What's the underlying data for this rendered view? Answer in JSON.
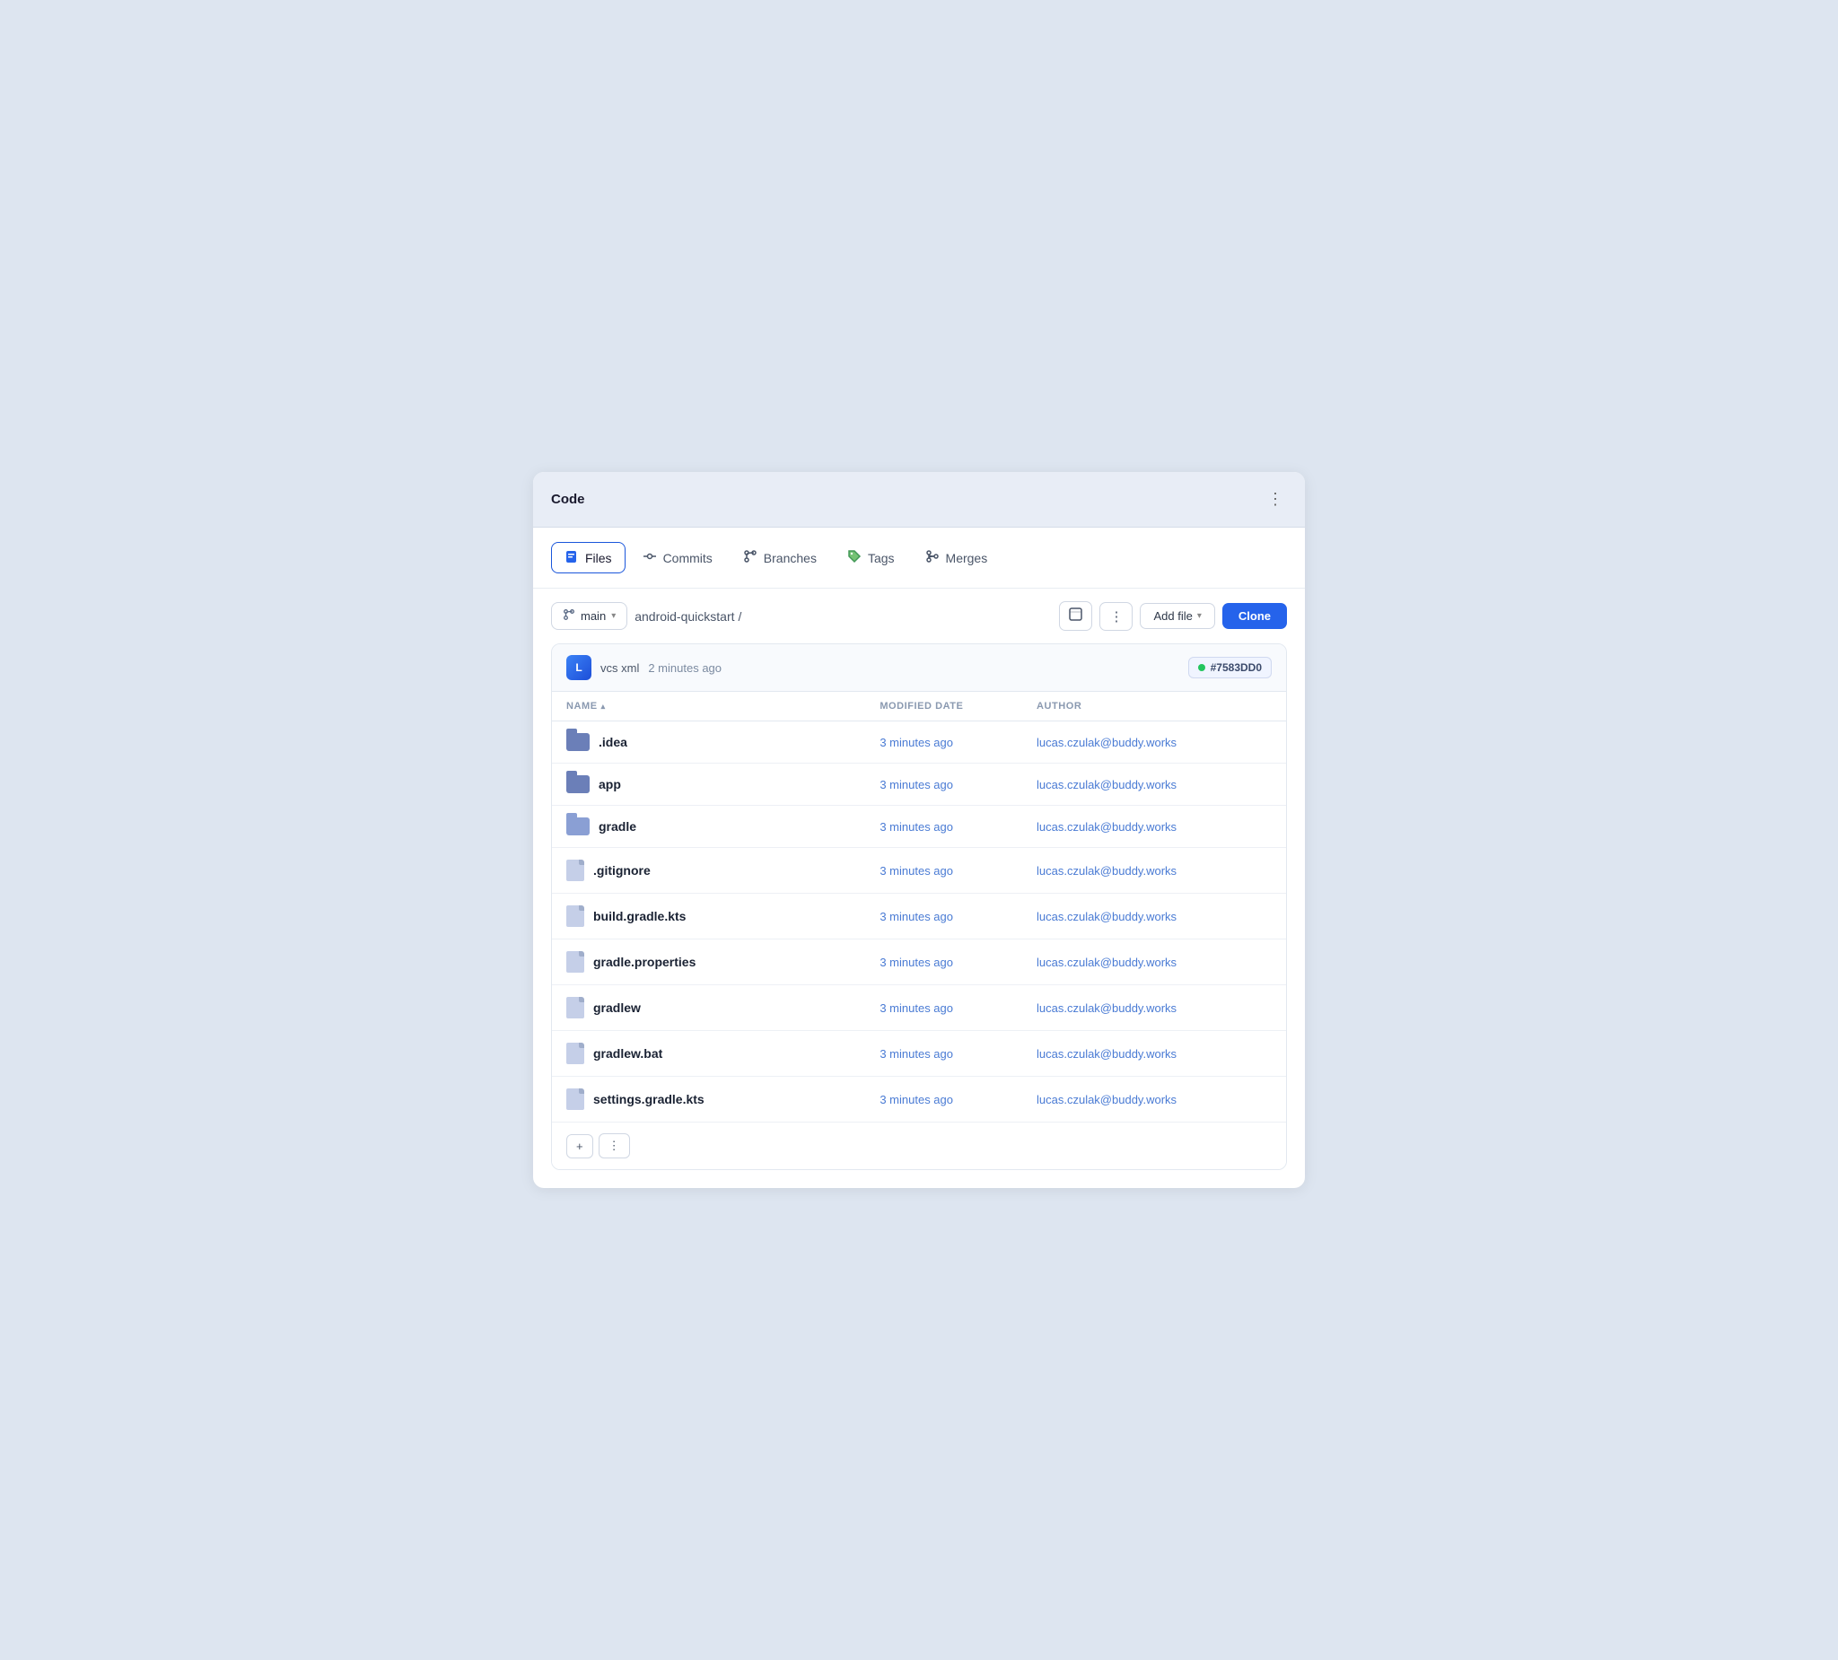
{
  "panel": {
    "title": "Code",
    "menu_icon": "⋮"
  },
  "tabs": [
    {
      "id": "files",
      "label": "Files",
      "icon": "🗂️",
      "active": true
    },
    {
      "id": "commits",
      "label": "Commits",
      "icon": "⑂",
      "active": false
    },
    {
      "id": "branches",
      "label": "Branches",
      "icon": "⑂",
      "active": false
    },
    {
      "id": "tags",
      "label": "Tags",
      "icon": "🏷️",
      "active": false
    },
    {
      "id": "merges",
      "label": "Merges",
      "icon": "⑂",
      "active": false
    }
  ],
  "toolbar": {
    "branch": "main",
    "breadcrumb_path": "android-quickstart",
    "breadcrumb_separator": "/",
    "add_file_label": "Add file",
    "clone_label": "Clone"
  },
  "commit": {
    "author_initial": "L",
    "message": "vcs xml",
    "time": "2 minutes ago",
    "hash": "#7583DD0",
    "hash_dot_color": "#22c55e"
  },
  "table": {
    "columns": [
      {
        "id": "name",
        "label": "NAME",
        "sortable": true
      },
      {
        "id": "modified",
        "label": "MODIFIED DATE",
        "sortable": false
      },
      {
        "id": "author",
        "label": "AUTHOR",
        "sortable": false
      }
    ],
    "rows": [
      {
        "icon": "folder",
        "name": ".idea",
        "modified": "3 minutes ago",
        "author": "lucas.czulak@buddy.works",
        "is_folder": true
      },
      {
        "icon": "folder",
        "name": "app",
        "modified": "3 minutes ago",
        "author": "lucas.czulak@buddy.works",
        "is_folder": true
      },
      {
        "icon": "folder",
        "name": "gradle",
        "modified": "3 minutes ago",
        "author": "lucas.czulak@buddy.works",
        "is_folder": true
      },
      {
        "icon": "file",
        "name": ".gitignore",
        "modified": "3 minutes ago",
        "author": "lucas.czulak@buddy.works",
        "is_folder": false
      },
      {
        "icon": "file",
        "name": "build.gradle.kts",
        "modified": "3 minutes ago",
        "author": "lucas.czulak@buddy.works",
        "is_folder": false
      },
      {
        "icon": "file",
        "name": "gradle.properties",
        "modified": "3 minutes ago",
        "author": "lucas.czulak@buddy.works",
        "is_folder": false
      },
      {
        "icon": "file",
        "name": "gradlew",
        "modified": "3 minutes ago",
        "author": "lucas.czulak@buddy.works",
        "is_folder": false
      },
      {
        "icon": "file",
        "name": "gradlew.bat",
        "modified": "3 minutes ago",
        "author": "lucas.czulak@buddy.works",
        "is_folder": false
      },
      {
        "icon": "file",
        "name": "settings.gradle.kts",
        "modified": "3 minutes ago",
        "author": "lucas.czulak@buddy.works",
        "is_folder": false
      }
    ]
  },
  "bottom_actions": {
    "plus_label": "+",
    "dots_label": "⋮"
  }
}
